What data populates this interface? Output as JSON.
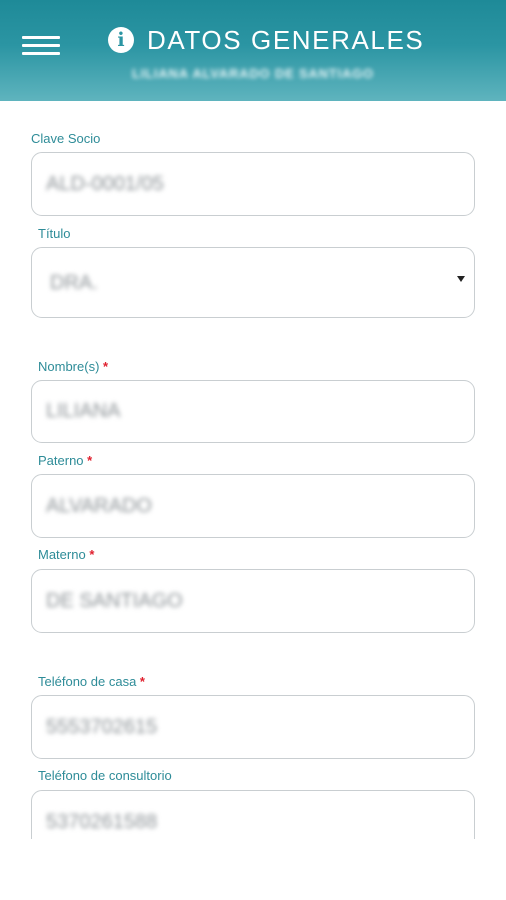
{
  "header": {
    "title": "DATOS GENERALES",
    "subtitle": "LILIANA ALVARADO DE SANTIAGO"
  },
  "form": {
    "clave_socio": {
      "label": "Clave Socio",
      "value": "ALD-0001/05"
    },
    "titulo": {
      "label": "Título",
      "value": "DRA."
    },
    "nombre": {
      "label": "Nombre(s)",
      "value": "LILIANA"
    },
    "paterno": {
      "label": "Paterno",
      "value": "ALVARADO"
    },
    "materno": {
      "label": "Materno",
      "value": "DE SANTIAGO"
    },
    "telefono_casa": {
      "label": "Teléfono de casa",
      "value": "5553702615"
    },
    "telefono_consultorio": {
      "label": "Teléfono de consultorio",
      "value": "5370261588"
    },
    "required_marker": "*"
  },
  "colors": {
    "accent": "#2b95a3",
    "label": "#2e8c98",
    "required": "#e0202e"
  }
}
